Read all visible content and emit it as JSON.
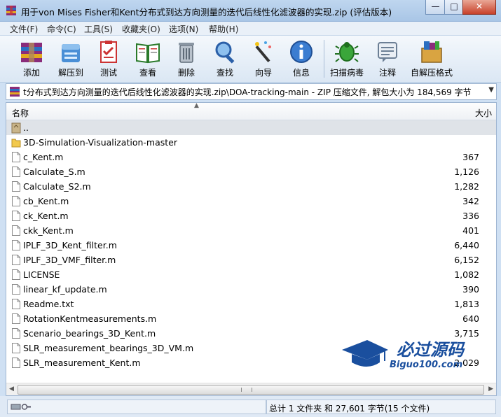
{
  "window": {
    "title": "用于von Mises Fisher和Kent分布式到达方向测量的迭代后线性化滤波器的实现.zip (评估版本)",
    "minimize_glyph": "—",
    "maximize_glyph": "□",
    "close_glyph": "✕"
  },
  "menu": [
    "文件(F)",
    "命令(C)",
    "工具(S)",
    "收藏夹(O)",
    "选项(N)",
    "帮助(H)"
  ],
  "toolbar": {
    "buttons": [
      {
        "label": "添加",
        "icon": "add-archive-icon"
      },
      {
        "label": "解压到",
        "icon": "extract-to-icon"
      },
      {
        "label": "测试",
        "icon": "test-icon"
      },
      {
        "label": "查看",
        "icon": "view-icon"
      },
      {
        "label": "删除",
        "icon": "delete-icon"
      },
      {
        "label": "查找",
        "icon": "find-icon"
      },
      {
        "label": "向导",
        "icon": "wizard-icon"
      },
      {
        "label": "信息",
        "icon": "info-icon"
      },
      {
        "label": "扫描病毒",
        "icon": "virus-scan-icon"
      },
      {
        "label": "注释",
        "icon": "comment-icon"
      },
      {
        "label": "自解压格式",
        "icon": "sfx-icon"
      }
    ]
  },
  "address": {
    "path": "t分布式到达方向测量的迭代后线性化滤波器的实现.zip\\DOA-tracking-main - ZIP 压缩文件, 解包大小为 184,569 字节",
    "dropdown_glyph": "▼"
  },
  "list": {
    "columns": {
      "name": "名称",
      "size": "大小"
    },
    "rows": [
      {
        "name": "..",
        "size": "",
        "type": "parent"
      },
      {
        "name": "3D-Simulation-Visualization-master",
        "size": "",
        "type": "folder"
      },
      {
        "name": "c_Kent.m",
        "size": "367",
        "type": "file"
      },
      {
        "name": "Calculate_S.m",
        "size": "1,126",
        "type": "file"
      },
      {
        "name": "Calculate_S2.m",
        "size": "1,282",
        "type": "file"
      },
      {
        "name": "cb_Kent.m",
        "size": "342",
        "type": "file"
      },
      {
        "name": "ck_Kent.m",
        "size": "336",
        "type": "file"
      },
      {
        "name": "ckk_Kent.m",
        "size": "401",
        "type": "file"
      },
      {
        "name": "IPLF_3D_Kent_filter.m",
        "size": "6,440",
        "type": "file"
      },
      {
        "name": "IPLF_3D_VMF_filter.m",
        "size": "6,152",
        "type": "file"
      },
      {
        "name": "LICENSE",
        "size": "1,082",
        "type": "file"
      },
      {
        "name": "linear_kf_update.m",
        "size": "390",
        "type": "file"
      },
      {
        "name": "Readme.txt",
        "size": "1,813",
        "type": "file"
      },
      {
        "name": "RotationKentmeasurements.m",
        "size": "640",
        "type": "file"
      },
      {
        "name": "Scenario_bearings_3D_Kent.m",
        "size": "3,715",
        "type": "file"
      },
      {
        "name": "SLR_measurement_bearings_3D_VM.m",
        "size": "",
        "type": "file"
      },
      {
        "name": "SLR_measurement_Kent.m",
        "size": "2,029",
        "type": "file"
      }
    ]
  },
  "statusbar": {
    "right": "总计 1 文件夹 和 27,601 字节(15 个文件)"
  },
  "watermark": {
    "big": "必过源码",
    "small": "Biguo100.com"
  }
}
